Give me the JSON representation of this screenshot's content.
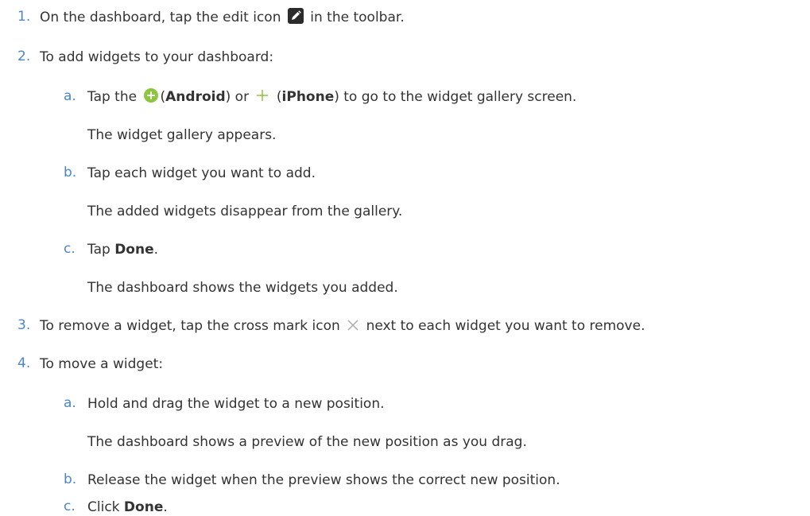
{
  "steps": {
    "s1": {
      "num": "1.",
      "pre": "On the dashboard, tap the edit icon",
      "post": "in the toolbar."
    },
    "s2": {
      "num": "2.",
      "text": "To add widgets to your dashboard:"
    },
    "s2a": {
      "letter": "a.",
      "t1": "Tap the ",
      "t2": "(",
      "android": "Android",
      "t3": ") or ",
      "t4": " (",
      "iphone": "iPhone",
      "t5": ") to go to the widget gallery screen.",
      "result": "The widget gallery appears."
    },
    "s2b": {
      "letter": "b.",
      "text": "Tap each widget you want to add.",
      "result": "The added widgets disappear from the gallery."
    },
    "s2c": {
      "letter": "c.",
      "t1": "Tap ",
      "bold": "Done",
      "t2": ".",
      "result": "The dashboard shows the widgets you added."
    },
    "s3": {
      "num": "3.",
      "pre": "To remove a widget, tap the cross mark icon",
      "post": "next to each widget you want to remove."
    },
    "s4": {
      "num": "4.",
      "text": "To move a widget:"
    },
    "s4a": {
      "letter": "a.",
      "text": "Hold and drag the widget to a new position.",
      "result": "The dashboard shows a preview of the new position as you drag."
    },
    "s4b": {
      "letter": "b.",
      "text": "Release the widget when the preview shows the correct new position."
    },
    "s4c": {
      "letter": "c.",
      "t1": "Click ",
      "bold": "Done",
      "t2": "."
    }
  },
  "colors": {
    "marker": "#4a86c8",
    "text": "#333333",
    "android_plus": "#8cc63f",
    "icon_dark": "#2b2b2b",
    "cross": "#aaaaaa"
  },
  "icons": [
    "edit-icon",
    "android-add-icon",
    "iphone-add-icon",
    "cross-mark-icon"
  ]
}
